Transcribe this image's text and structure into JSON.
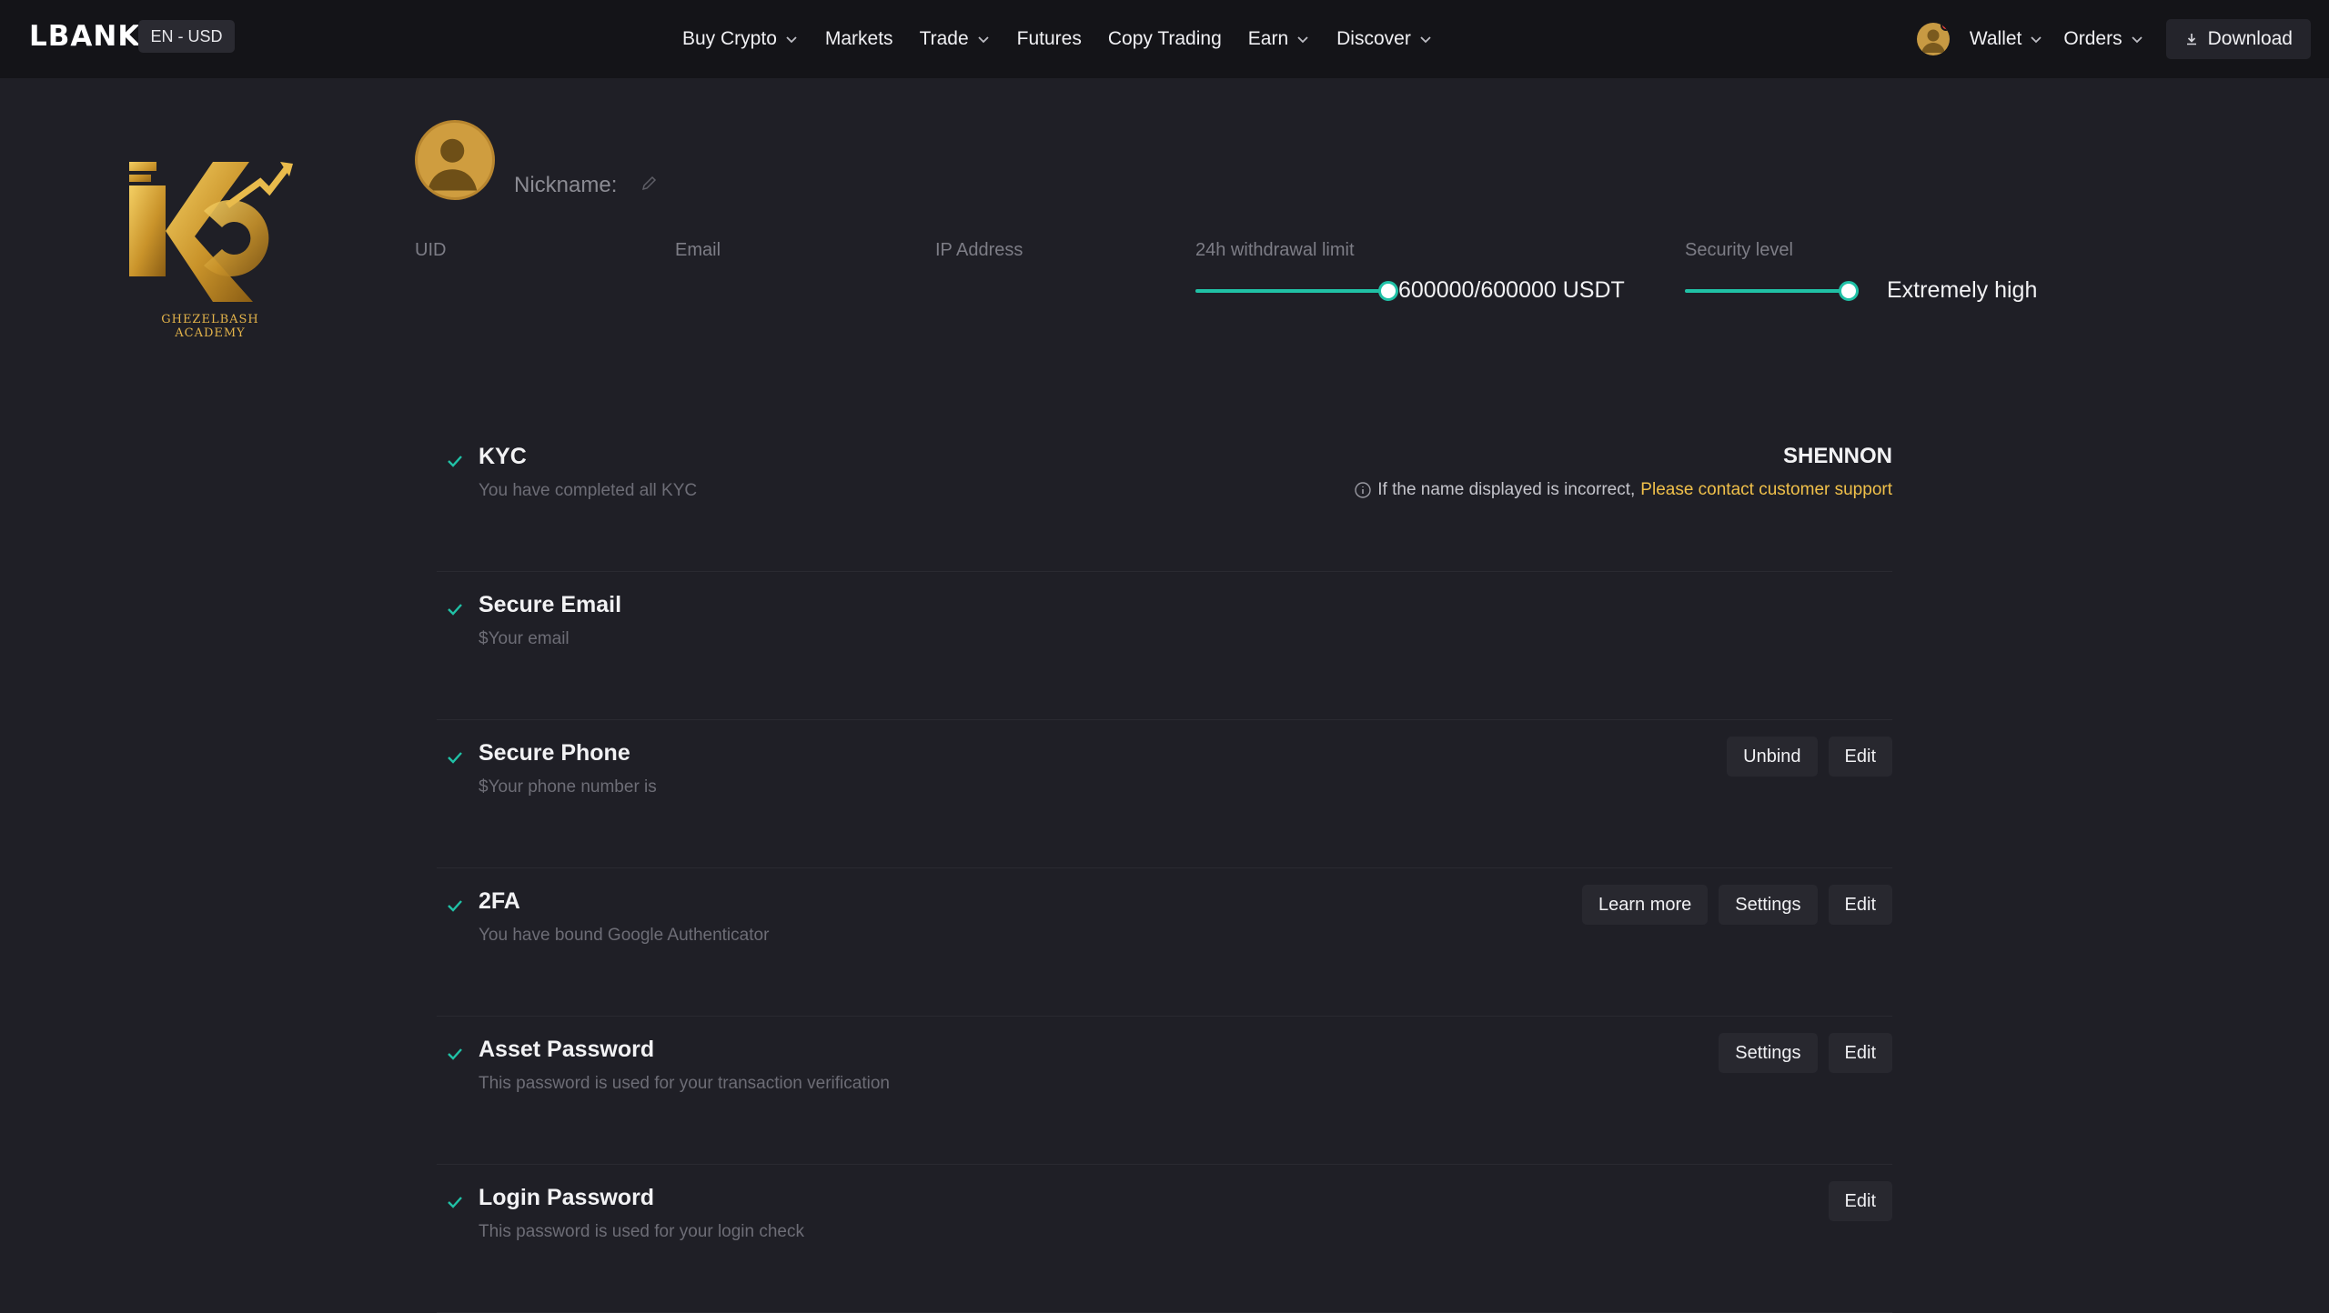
{
  "header": {
    "brand": "LBANK",
    "lang_currency": "EN - USD",
    "nav": [
      {
        "label": "Buy Crypto",
        "dropdown": true
      },
      {
        "label": "Markets",
        "dropdown": false
      },
      {
        "label": "Trade",
        "dropdown": true
      },
      {
        "label": "Futures",
        "dropdown": false
      },
      {
        "label": "Copy Trading",
        "dropdown": false
      },
      {
        "label": "Earn",
        "dropdown": true
      },
      {
        "label": "Discover",
        "dropdown": true
      }
    ],
    "wallet_label": "Wallet",
    "orders_label": "Orders",
    "download_label": "Download"
  },
  "academy_logo": {
    "caption": "GHEZELBASH ACADEMY"
  },
  "profile": {
    "nickname_label": "Nickname:",
    "uid_label": "UID",
    "email_label": "Email",
    "ip_label": "IP Address",
    "withdrawal_label": "24h withdrawal limit",
    "withdrawal_value": "600000/600000 USDT",
    "withdrawal_progress": 1.0,
    "security_label": "Security level",
    "security_value": "Extremely high",
    "security_progress": 1.0
  },
  "security": {
    "kyc": {
      "title": "KYC",
      "desc": "You have completed all KYC",
      "name": "SHENNON",
      "note_text": "If the name displayed is incorrect,",
      "note_link": "Please contact customer support"
    },
    "email": {
      "title": "Secure Email",
      "desc": "$Your email"
    },
    "phone": {
      "title": "Secure Phone",
      "desc": "$Your phone number is",
      "unbind_label": "Unbind",
      "edit_label": "Edit"
    },
    "twofa": {
      "title": "2FA",
      "desc": "You have bound Google Authenticator",
      "learn_label": "Learn more",
      "settings_label": "Settings",
      "edit_label": "Edit"
    },
    "asset": {
      "title": "Asset Password",
      "desc": "This password is used for your transaction verification",
      "settings_label": "Settings",
      "edit_label": "Edit"
    },
    "login": {
      "title": "Login Password",
      "desc": "This password is used for your login check",
      "edit_label": "Edit"
    }
  },
  "colors": {
    "accent_teal": "#20c1a6",
    "link_gold": "#f0c04a",
    "notification_red": "#e5383b",
    "avatar_gold": "#cf9d3f"
  }
}
